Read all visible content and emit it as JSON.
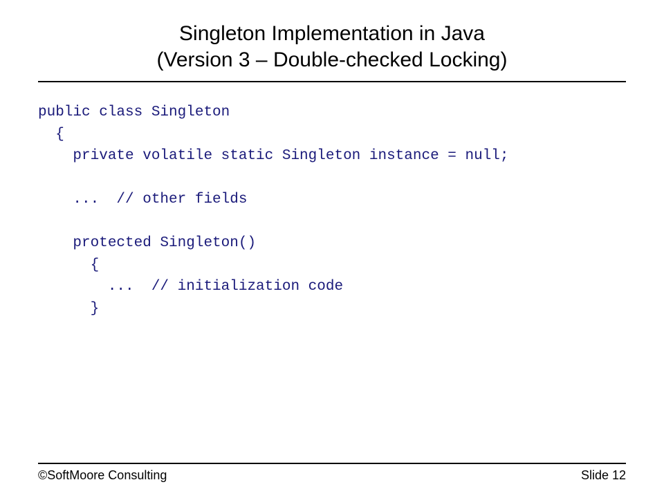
{
  "title": {
    "line1": "Singleton Implementation in Java",
    "line2": "(Version 3 – Double-checked Locking)"
  },
  "code": "public class Singleton\n  {\n    private volatile static Singleton instance = null;\n\n    ...  // other fields\n\n    protected Singleton()\n      {\n        ...  // initialization code\n      }",
  "footer": {
    "left": "©SoftMoore Consulting",
    "right": "Slide 12"
  }
}
